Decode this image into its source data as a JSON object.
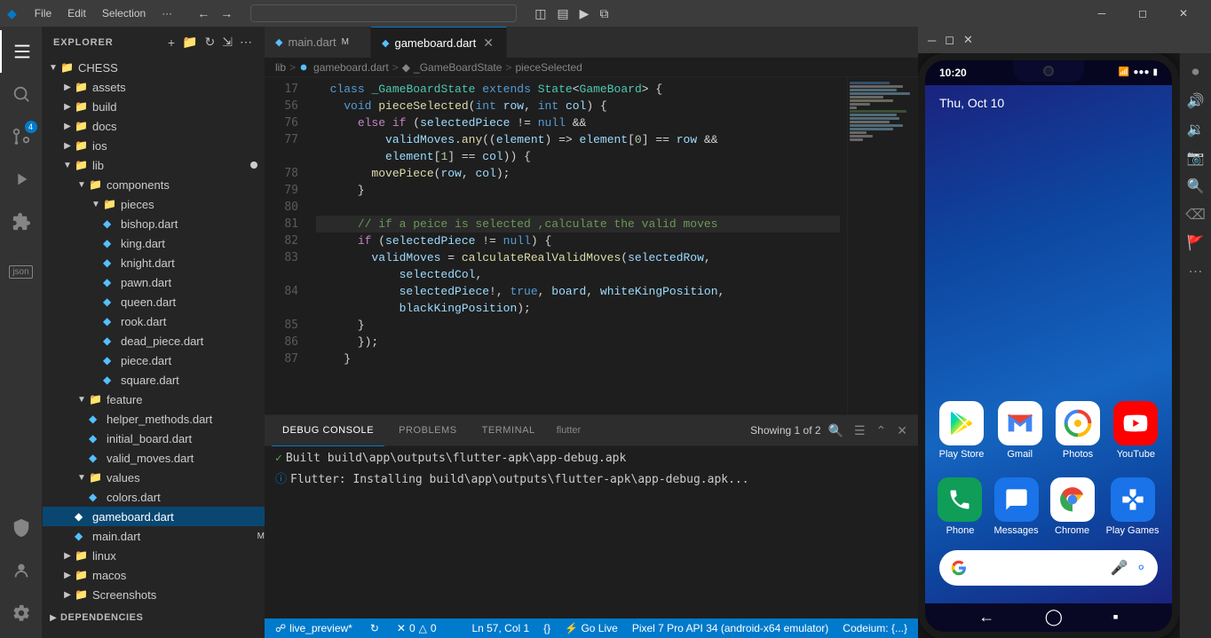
{
  "titlebar": {
    "app_name": "VS Code",
    "menus": [
      "File",
      "Edit",
      "Selection",
      "···"
    ],
    "search_placeholder": "",
    "win_controls": [
      "🗕",
      "🗗",
      "✕"
    ]
  },
  "activity_bar": {
    "icons": [
      {
        "name": "explorer-icon",
        "symbol": "⎘",
        "active": true
      },
      {
        "name": "search-icon",
        "symbol": "🔍"
      },
      {
        "name": "source-control-icon",
        "symbol": "⑂",
        "badge": "4"
      },
      {
        "name": "run-icon",
        "symbol": "▷"
      },
      {
        "name": "extensions-icon",
        "symbol": "⊞"
      }
    ],
    "bottom_icons": [
      {
        "name": "remote-icon",
        "symbol": "⊙"
      },
      {
        "name": "accounts-icon",
        "symbol": "◯"
      },
      {
        "name": "settings-icon",
        "symbol": "⚙"
      }
    ]
  },
  "sidebar": {
    "title": "EXPLORER",
    "root": "CHESS",
    "tree": [
      {
        "id": "assets",
        "label": "assets",
        "type": "folder",
        "indent": 1,
        "open": false
      },
      {
        "id": "build",
        "label": "build",
        "type": "folder",
        "indent": 1,
        "open": false
      },
      {
        "id": "docs",
        "label": "docs",
        "type": "folder",
        "indent": 1,
        "open": false
      },
      {
        "id": "ios",
        "label": "ios",
        "type": "folder",
        "indent": 1,
        "open": false
      },
      {
        "id": "lib",
        "label": "lib",
        "type": "folder",
        "indent": 1,
        "open": true,
        "modified": true
      },
      {
        "id": "components",
        "label": "components",
        "type": "folder",
        "indent": 2,
        "open": true
      },
      {
        "id": "pieces",
        "label": "pieces",
        "type": "folder",
        "indent": 3,
        "open": true
      },
      {
        "id": "bishop.dart",
        "label": "bishop.dart",
        "type": "dart",
        "indent": 4
      },
      {
        "id": "king.dart",
        "label": "king.dart",
        "type": "dart",
        "indent": 4
      },
      {
        "id": "knight.dart",
        "label": "knight.dart",
        "type": "dart",
        "indent": 4
      },
      {
        "id": "pawn.dart",
        "label": "pawn.dart",
        "type": "dart",
        "indent": 4
      },
      {
        "id": "queen.dart",
        "label": "queen.dart",
        "type": "dart",
        "indent": 4
      },
      {
        "id": "rook.dart",
        "label": "rook.dart",
        "type": "dart",
        "indent": 4
      },
      {
        "id": "dead_piece.dart",
        "label": "dead_piece.dart",
        "type": "dart",
        "indent": 4
      },
      {
        "id": "piece.dart",
        "label": "piece.dart",
        "type": "dart",
        "indent": 4
      },
      {
        "id": "square.dart",
        "label": "square.dart",
        "type": "dart",
        "indent": 4
      },
      {
        "id": "feature",
        "label": "feature",
        "type": "folder",
        "indent": 2,
        "open": true
      },
      {
        "id": "helper_methods.dart",
        "label": "helper_methods.dart",
        "type": "dart",
        "indent": 3
      },
      {
        "id": "initial_board.dart",
        "label": "initial_board.dart",
        "type": "dart",
        "indent": 3
      },
      {
        "id": "valid_moves.dart",
        "label": "valid_moves.dart",
        "type": "dart",
        "indent": 3
      },
      {
        "id": "values",
        "label": "values",
        "type": "folder",
        "indent": 2,
        "open": true
      },
      {
        "id": "colors.dart",
        "label": "colors.dart",
        "type": "dart",
        "indent": 3
      },
      {
        "id": "gameboard.dart",
        "label": "gameboard.dart",
        "type": "dart",
        "indent": 2,
        "active": true
      },
      {
        "id": "main.dart",
        "label": "main.dart",
        "type": "dart",
        "indent": 2,
        "modified": true
      },
      {
        "id": "linux",
        "label": "linux",
        "type": "folder",
        "indent": 1,
        "open": false
      },
      {
        "id": "macos",
        "label": "macos",
        "type": "folder",
        "indent": 1,
        "open": false
      },
      {
        "id": "Screenshots",
        "label": "Screenshots",
        "type": "folder",
        "indent": 1,
        "open": false
      }
    ],
    "dependencies": "DEPENDENCIES"
  },
  "tabs": [
    {
      "id": "main.dart",
      "label": "main.dart",
      "modified": true,
      "active": false
    },
    {
      "id": "gameboard.dart",
      "label": "gameboard.dart",
      "modified": false,
      "active": true
    }
  ],
  "breadcrumb": {
    "items": [
      "lib",
      "gameboard.dart",
      "_GameBoardState",
      "pieceSelected"
    ]
  },
  "editor": {
    "lines": [
      {
        "num": 17,
        "code": "  <kw>class</kw> <cls>_GameBoardState</cls> <kw>extends</kw> <cls>State</cls>&lt;<cls>GameBoard</cls>&gt; {"
      },
      {
        "num": 56,
        "code": "    <kw>void</kw> <fn>pieceSelected</fn>(<kw>int</kw> <param>row</param>, <kw>int</kw> <param>col</param>) {"
      },
      {
        "num": 76,
        "code": "      <kw2>else</kw2> <kw2>if</kw2> (<param>selectedPiece</param> != <kw>null</kw> &&"
      },
      {
        "num": 77,
        "code": "          <param>validMoves</param>.<fn>any</fn>((<param>element</param>) =&gt; <param>element</param>[<num>0</num>] == <param>row</param> &&"
      },
      {
        "num": "",
        "code": "          <param>element</param>[<num>1</num>] == <param>col</param>)) {"
      },
      {
        "num": 78,
        "code": "        <fn>movePiece</fn>(<param>row</param>, <param>col</param>);"
      },
      {
        "num": 79,
        "code": "      }"
      },
      {
        "num": 80,
        "code": ""
      },
      {
        "num": 81,
        "code": "      <cmt>// if a peice is selected ,calculate the valid moves</cmt>"
      },
      {
        "num": 82,
        "code": "      <kw2>if</kw2> (<param>selectedPiece</param> != <kw>null</kw>) {"
      },
      {
        "num": 83,
        "code": "        <param>validMoves</param> = <fn>calculateRealValidMoves</fn>(<param>selectedRow</param>,"
      },
      {
        "num": "",
        "code": "            <param>selectedCol</param>,"
      },
      {
        "num": 84,
        "code": "            <param>selectedPiece</param>!, <bool>true</bool>, <param>board</param>, <param>whiteKingPosition</param>,"
      },
      {
        "num": "",
        "code": "            <param>blackKingPosition</param>);"
      },
      {
        "num": 85,
        "code": "      }"
      },
      {
        "num": 86,
        "code": "      });"
      },
      {
        "num": 87,
        "code": "    }"
      }
    ]
  },
  "bottom_panel": {
    "tabs": [
      "DEBUG CONSOLE",
      "PROBLEMS",
      "TERMINAL"
    ],
    "active_tab": "DEBUG CONSOLE",
    "filter_label": "flutter",
    "showing": "Showing 1 of 2",
    "console_output": [
      {
        "type": "check",
        "text": "Built build\\app\\outputs\\flutter-apk\\app-debug.apk"
      },
      {
        "type": "info",
        "text": "Flutter: Installing build\\app\\outputs\\flutter-apk\\app-debug.apk..."
      }
    ]
  },
  "status_bar": {
    "branch": "live_preview*",
    "errors": "0",
    "warnings": "0",
    "position": "Ln 57, Col 1",
    "braces": "{}",
    "go_live": "⚡ Go Live",
    "device": "Pixel 7 Pro API 34 (android-x64 emulator)",
    "extension": "Codeium: {...}"
  },
  "emulator": {
    "phone": {
      "time": "10:20",
      "date": "Thu, Oct 10",
      "apps_row1": [
        {
          "label": "Play Store",
          "color": "#ffffff",
          "icon": "playstore"
        },
        {
          "label": "Gmail",
          "color": "#ffffff",
          "icon": "gmail"
        },
        {
          "label": "Photos",
          "color": "#ffffff",
          "icon": "photos"
        },
        {
          "label": "YouTube",
          "color": "#ff0000",
          "icon": "youtube"
        }
      ],
      "apps_row2": [
        {
          "label": "Phone",
          "color": "#0f9d58",
          "icon": "phone"
        },
        {
          "label": "Messages",
          "color": "#1a73e8",
          "icon": "messages"
        },
        {
          "label": "Chrome",
          "color": "#ffffff",
          "icon": "chrome"
        },
        {
          "label": "Play Games",
          "color": "#1a73e8",
          "icon": "gamepad"
        }
      ]
    }
  }
}
